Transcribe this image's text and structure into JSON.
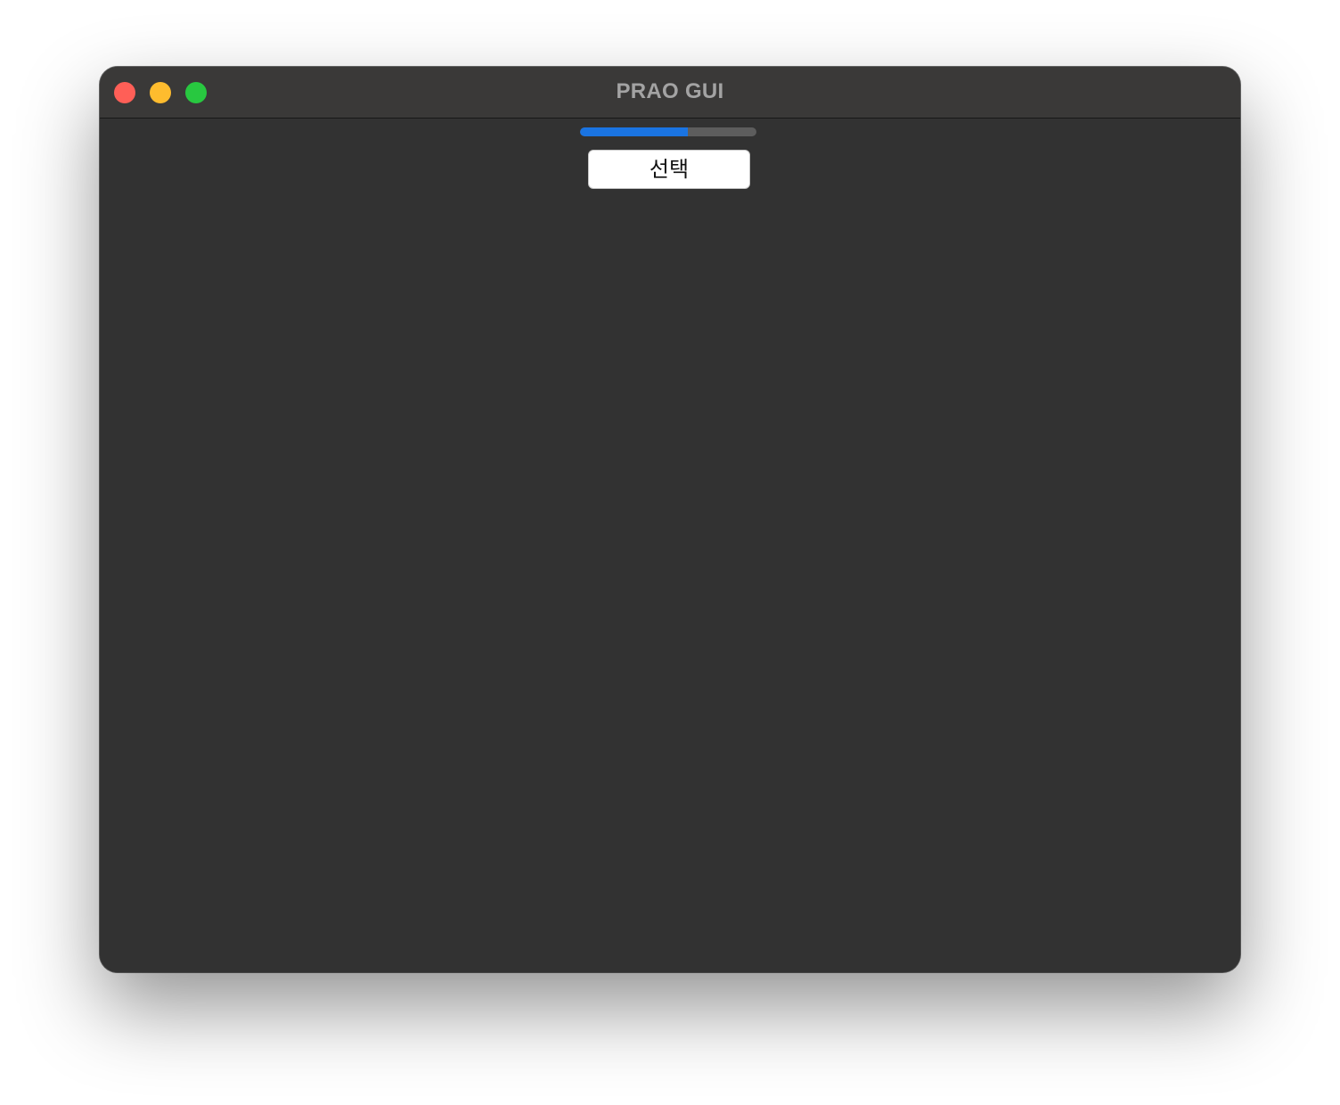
{
  "window": {
    "title": "PRAO GUI",
    "traffic_lights": [
      {
        "name": "close",
        "color": "#ff5f57"
      },
      {
        "name": "minimize",
        "color": "#febc2e"
      },
      {
        "name": "zoom",
        "color": "#28c840"
      }
    ]
  },
  "main": {
    "progress": {
      "value_percent": 61,
      "fill_color": "#1a74e2"
    },
    "select_button": {
      "label": "선택"
    }
  }
}
